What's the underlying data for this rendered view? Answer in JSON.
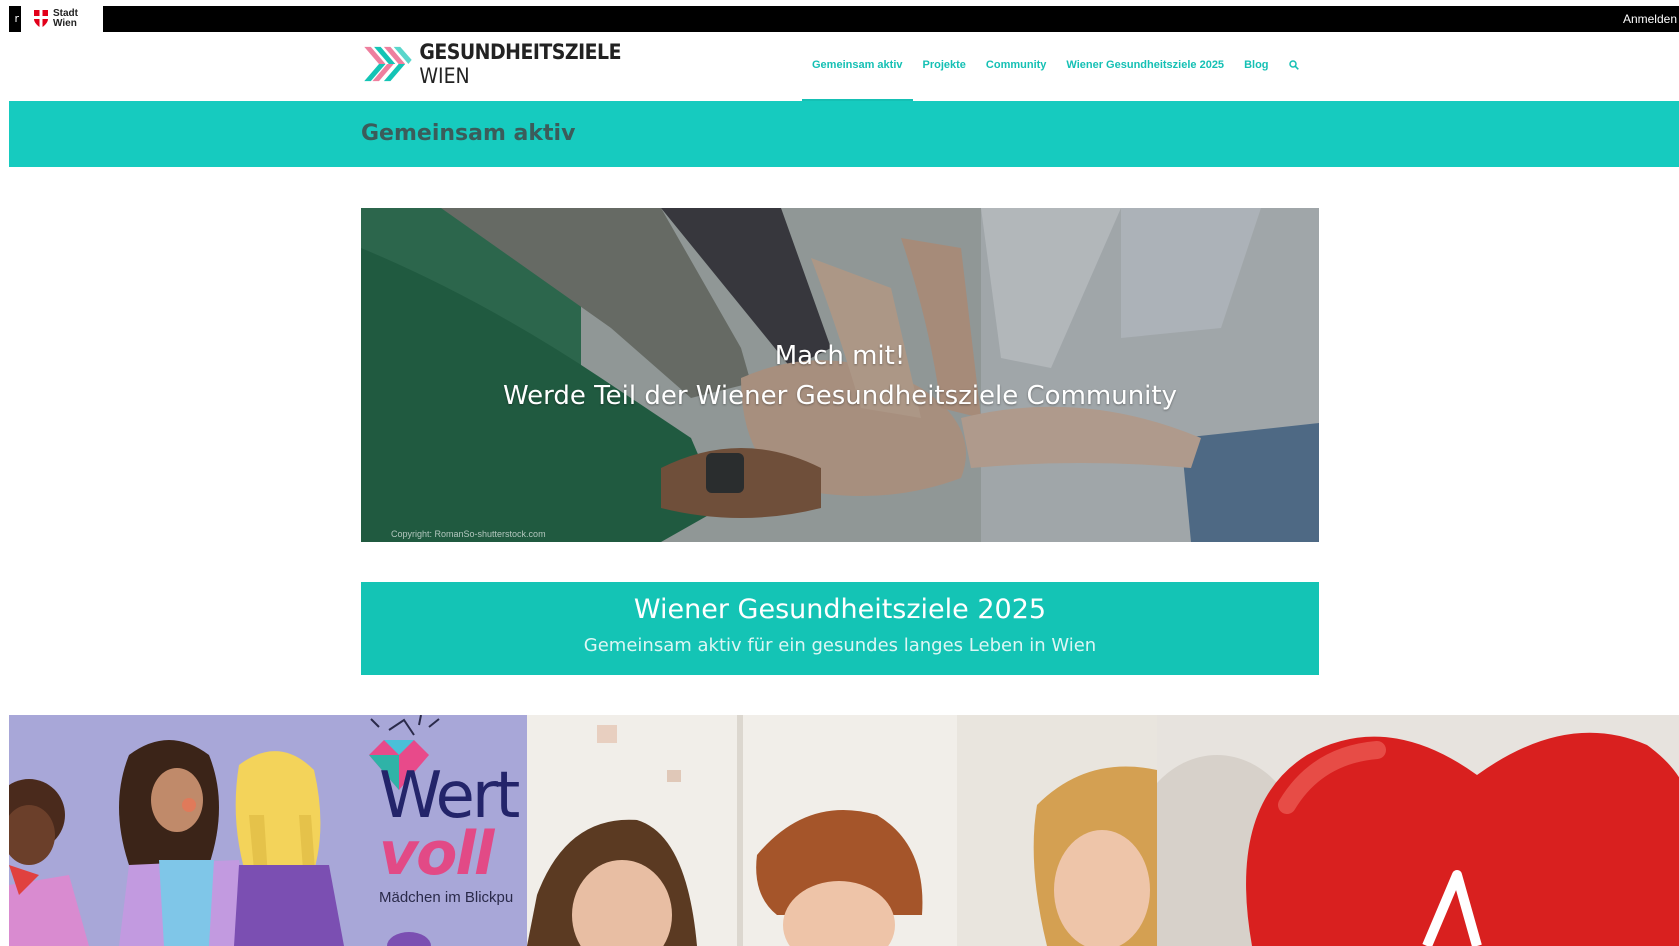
{
  "topbar": {
    "left_stub": "r",
    "stadt_line1": "Stadt",
    "stadt_line2": "Wien",
    "login": "Anmelden"
  },
  "header": {
    "logo_line1": "GESUNDHEITSZIELE",
    "logo_line2": "WIEN",
    "nav": [
      {
        "label": "Gemeinsam aktiv",
        "active": true
      },
      {
        "label": "Projekte",
        "active": false
      },
      {
        "label": "Community",
        "active": false
      },
      {
        "label": "Wiener Gesundheitsziele 2025",
        "active": false
      },
      {
        "label": "Blog",
        "active": false
      }
    ],
    "search_icon": "search-icon"
  },
  "page": {
    "title": "Gemeinsam aktiv"
  },
  "hero": {
    "line1": "Mach mit!",
    "line2": "Werde Teil der Wiener Gesundheitsziele Community",
    "copyright": "Copyright: RomanSo-shutterstock.com"
  },
  "banner": {
    "title": "Wiener Gesundheitsziele 2025",
    "subtitle": "Gemeinsam aktiv für ein gesundes langes Leben in Wien"
  },
  "tiles": {
    "tile1": {
      "word1": "Wert",
      "word2": "voll",
      "caption": "Mädchen im Blickpu"
    }
  },
  "colors": {
    "accent": "#16cbbf",
    "banner": "#14c4b5",
    "nav_text": "#15c0b4",
    "title_text": "#3b5c5a"
  }
}
